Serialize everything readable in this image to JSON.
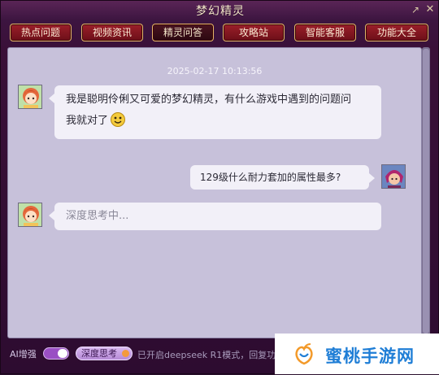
{
  "window": {
    "title": "梦幻精灵"
  },
  "tabs": [
    "热点问题",
    "视频资讯",
    "精灵问答",
    "攻略站",
    "智能客服",
    "功能大全"
  ],
  "active_tab": "精灵问答",
  "chat": {
    "timestamp": "2025-02-17 10:13:56",
    "messages": [
      {
        "sender": "bot",
        "line1": "我是聪明伶俐又可爱的梦幻精灵，有什么游戏中遇到的问题问",
        "line2": "我就对了"
      },
      {
        "sender": "user",
        "text": "129级什么耐力套加的属性最多?"
      },
      {
        "sender": "bot",
        "text": "深度思考中..."
      }
    ]
  },
  "bottombar": {
    "ai_label": "AI增强",
    "ai_toggle_on": true,
    "deep_button": "深度思考",
    "status_text": "已开启deepseek R1模式，回复功"
  },
  "watermark": {
    "text": "蜜桃手游网"
  },
  "icons": {
    "pop-out": "arrow-up-right-icon",
    "close": "close-icon",
    "emoji": "smile-emoji-icon",
    "logo": "peach-logo-icon"
  }
}
